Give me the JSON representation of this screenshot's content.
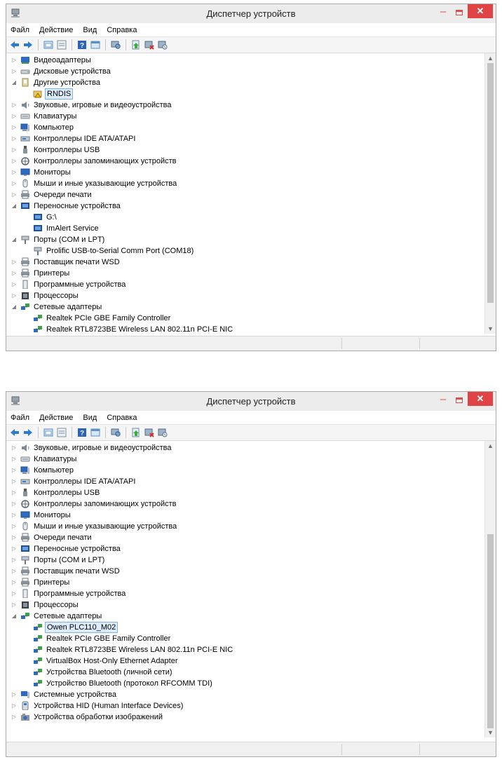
{
  "window": {
    "title": "Диспетчер устройств",
    "close_glyph": "✕",
    "minimize_glyph": "–"
  },
  "menu": [
    "Файл",
    "Действие",
    "Вид",
    "Справка"
  ],
  "toolbar_icons": [
    "back-icon",
    "forward-icon",
    "separator",
    "show-hidden-icon",
    "properties-icon",
    "separator",
    "help-icon",
    "view-icon",
    "separator",
    "scan-hardware-icon",
    "separator",
    "update-driver-icon",
    "uninstall-icon",
    "disable-icon"
  ],
  "colors": {
    "accent_selection": "#dcecfc",
    "close_button": "#e04343",
    "title_bar": "#ececec"
  },
  "window1": {
    "scroll": {
      "top_fraction": 0.0,
      "visible_fraction": 0.92
    },
    "rows": [
      {
        "label": "Видеоадаптеры",
        "depth": 1,
        "expander": "collapsed",
        "icon": "display-adapter-icon"
      },
      {
        "label": "Дисковые устройства",
        "depth": 1,
        "expander": "collapsed",
        "icon": "disk-drive-icon"
      },
      {
        "label": "Другие устройства",
        "depth": 1,
        "expander": "expanded",
        "icon": "other-devices-icon"
      },
      {
        "label": "RNDIS",
        "depth": 2,
        "expander": "none",
        "icon": "unknown-device-icon",
        "selected": true
      },
      {
        "label": "Звуковые, игровые и видеоустройства",
        "depth": 1,
        "expander": "collapsed",
        "icon": "speaker-icon"
      },
      {
        "label": "Клавиатуры",
        "depth": 1,
        "expander": "collapsed",
        "icon": "keyboard-icon"
      },
      {
        "label": "Компьютер",
        "depth": 1,
        "expander": "collapsed",
        "icon": "computer-icon"
      },
      {
        "label": "Контроллеры IDE ATA/ATAPI",
        "depth": 1,
        "expander": "collapsed",
        "icon": "ide-controller-icon"
      },
      {
        "label": "Контроллеры USB",
        "depth": 1,
        "expander": "collapsed",
        "icon": "usb-icon"
      },
      {
        "label": "Контроллеры запоминающих устройств",
        "depth": 1,
        "expander": "collapsed",
        "icon": "storage-controller-icon"
      },
      {
        "label": "Мониторы",
        "depth": 1,
        "expander": "collapsed",
        "icon": "monitor-icon"
      },
      {
        "label": "Мыши и иные указывающие устройства",
        "depth": 1,
        "expander": "collapsed",
        "icon": "mouse-icon"
      },
      {
        "label": "Очереди печати",
        "depth": 1,
        "expander": "collapsed",
        "icon": "printer-icon"
      },
      {
        "label": "Переносные устройства",
        "depth": 1,
        "expander": "expanded",
        "icon": "portable-device-icon"
      },
      {
        "label": "G:\\",
        "depth": 2,
        "expander": "none",
        "icon": "portable-device-icon"
      },
      {
        "label": "ImAlert Service",
        "depth": 2,
        "expander": "none",
        "icon": "portable-device-icon"
      },
      {
        "label": "Порты (COM и LPT)",
        "depth": 1,
        "expander": "expanded",
        "icon": "port-icon"
      },
      {
        "label": "Prolific USB-to-Serial Comm Port (COM18)",
        "depth": 2,
        "expander": "none",
        "icon": "port-icon"
      },
      {
        "label": "Поставщик печати WSD",
        "depth": 1,
        "expander": "collapsed",
        "icon": "printer-icon"
      },
      {
        "label": "Принтеры",
        "depth": 1,
        "expander": "collapsed",
        "icon": "printer-icon"
      },
      {
        "label": "Программные устройства",
        "depth": 1,
        "expander": "collapsed",
        "icon": "software-device-icon"
      },
      {
        "label": "Процессоры",
        "depth": 1,
        "expander": "collapsed",
        "icon": "processor-icon"
      },
      {
        "label": "Сетевые адаптеры",
        "depth": 1,
        "expander": "expanded",
        "icon": "network-adapter-icon"
      },
      {
        "label": "Realtek PCIe GBE Family Controller",
        "depth": 2,
        "expander": "none",
        "icon": "network-adapter-icon"
      },
      {
        "label": "Realtek RTL8723BE Wireless LAN 802.11n PCI-E NIC",
        "depth": 2,
        "expander": "none",
        "icon": "network-adapter-icon"
      }
    ]
  },
  "window2": {
    "scroll": {
      "top_fraction": 0.3,
      "visible_fraction": 0.7
    },
    "rows": [
      {
        "label": "Звуковые, игровые и видеоустройства",
        "depth": 1,
        "expander": "collapsed",
        "icon": "speaker-icon"
      },
      {
        "label": "Клавиатуры",
        "depth": 1,
        "expander": "collapsed",
        "icon": "keyboard-icon"
      },
      {
        "label": "Компьютер",
        "depth": 1,
        "expander": "collapsed",
        "icon": "computer-icon"
      },
      {
        "label": "Контроллеры IDE ATA/ATAPI",
        "depth": 1,
        "expander": "collapsed",
        "icon": "ide-controller-icon"
      },
      {
        "label": "Контроллеры USB",
        "depth": 1,
        "expander": "collapsed",
        "icon": "usb-icon"
      },
      {
        "label": "Контроллеры запоминающих устройств",
        "depth": 1,
        "expander": "collapsed",
        "icon": "storage-controller-icon"
      },
      {
        "label": "Мониторы",
        "depth": 1,
        "expander": "collapsed",
        "icon": "monitor-icon"
      },
      {
        "label": "Мыши и иные указывающие устройства",
        "depth": 1,
        "expander": "collapsed",
        "icon": "mouse-icon"
      },
      {
        "label": "Очереди печати",
        "depth": 1,
        "expander": "collapsed",
        "icon": "printer-icon"
      },
      {
        "label": "Переносные устройства",
        "depth": 1,
        "expander": "collapsed",
        "icon": "portable-device-icon"
      },
      {
        "label": "Порты (COM и LPT)",
        "depth": 1,
        "expander": "collapsed",
        "icon": "port-icon"
      },
      {
        "label": "Поставщик печати WSD",
        "depth": 1,
        "expander": "collapsed",
        "icon": "printer-icon"
      },
      {
        "label": "Принтеры",
        "depth": 1,
        "expander": "collapsed",
        "icon": "printer-icon"
      },
      {
        "label": "Программные устройства",
        "depth": 1,
        "expander": "collapsed",
        "icon": "software-device-icon"
      },
      {
        "label": "Процессоры",
        "depth": 1,
        "expander": "collapsed",
        "icon": "processor-icon"
      },
      {
        "label": "Сетевые адаптеры",
        "depth": 1,
        "expander": "expanded",
        "icon": "network-adapter-icon"
      },
      {
        "label": "Owen PLC110_M02",
        "depth": 2,
        "expander": "none",
        "icon": "network-adapter-icon",
        "selected": true
      },
      {
        "label": "Realtek PCIe GBE Family Controller",
        "depth": 2,
        "expander": "none",
        "icon": "network-adapter-icon"
      },
      {
        "label": "Realtek RTL8723BE Wireless LAN 802.11n PCI-E NIC",
        "depth": 2,
        "expander": "none",
        "icon": "network-adapter-icon"
      },
      {
        "label": "VirtualBox Host-Only Ethernet Adapter",
        "depth": 2,
        "expander": "none",
        "icon": "network-adapter-icon"
      },
      {
        "label": "Устройства Bluetooth (личной сети)",
        "depth": 2,
        "expander": "none",
        "icon": "network-adapter-icon"
      },
      {
        "label": "Устройство Bluetooth (протокол RFCOMM TDI)",
        "depth": 2,
        "expander": "none",
        "icon": "network-adapter-icon"
      },
      {
        "label": "Системные устройства",
        "depth": 1,
        "expander": "collapsed",
        "icon": "system-device-icon"
      },
      {
        "label": "Устройства HID (Human Interface Devices)",
        "depth": 1,
        "expander": "collapsed",
        "icon": "hid-icon"
      },
      {
        "label": "Устройства обработки изображений",
        "depth": 1,
        "expander": "collapsed",
        "icon": "imaging-device-icon"
      }
    ]
  }
}
